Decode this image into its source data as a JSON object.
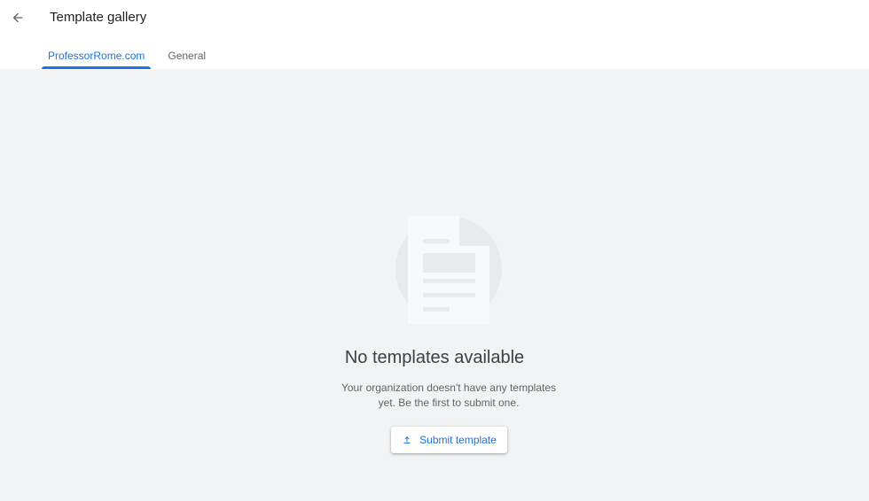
{
  "header": {
    "title": "Template gallery",
    "back_icon": "arrow-back-icon"
  },
  "tabs": [
    {
      "label": "ProfessorRome.com",
      "active": true
    },
    {
      "label": "General",
      "active": false
    }
  ],
  "empty_state": {
    "illustration_icon": "document-icon",
    "title": "No templates available",
    "description": "Your organization doesn't have any templates yet. Be the first to submit one.",
    "button": {
      "label": "Submit template",
      "icon": "upload-icon"
    }
  },
  "colors": {
    "accent": "#1a73e8",
    "background": "#f1f3f4",
    "title_text": "#3c4043",
    "secondary_text": "#5f6368"
  }
}
